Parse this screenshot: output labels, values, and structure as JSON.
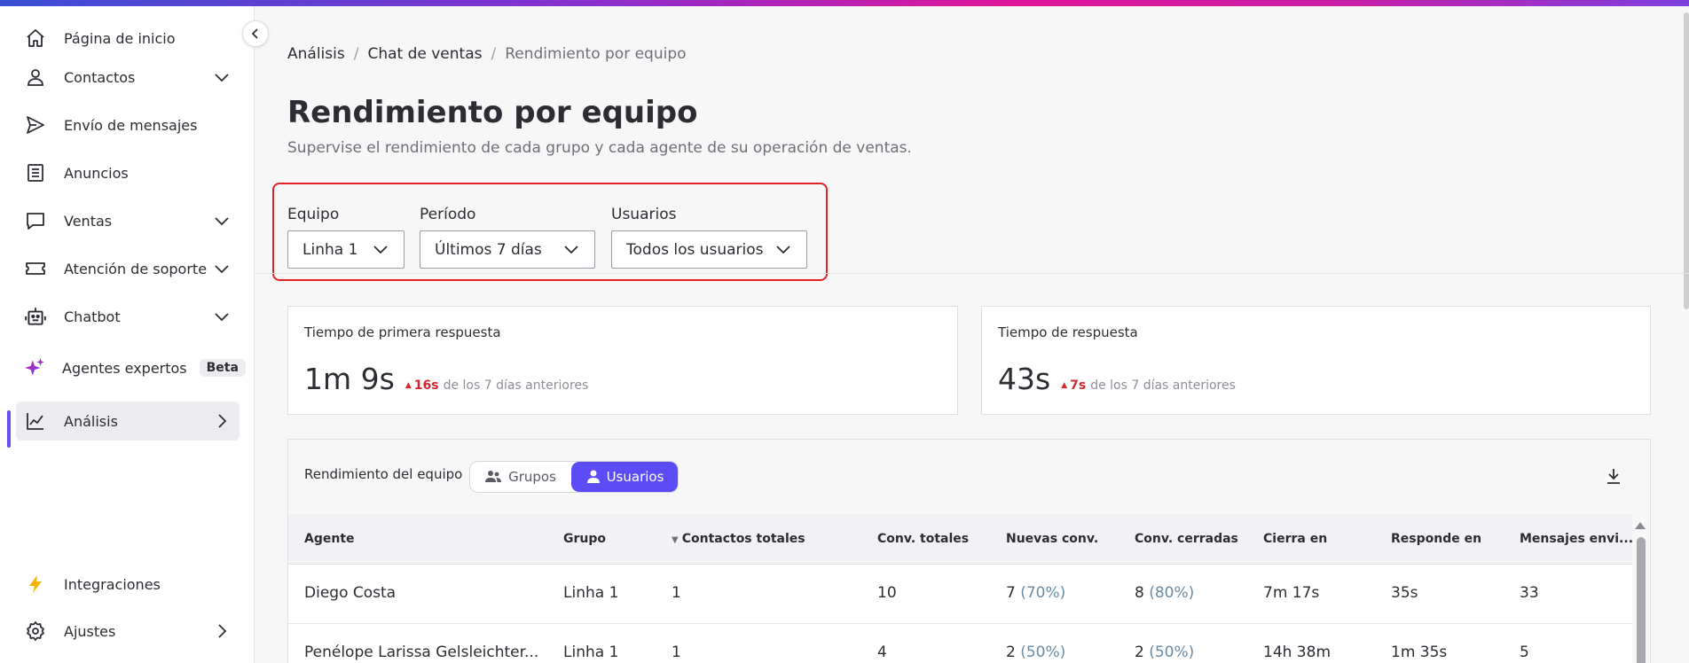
{
  "sidebar": {
    "items": [
      {
        "label": "Página de inicio",
        "icon": "home-icon"
      },
      {
        "label": "Contactos",
        "icon": "user-icon"
      },
      {
        "label": "Envío de mensajes",
        "icon": "send-icon"
      },
      {
        "label": "Anuncios",
        "icon": "document-icon"
      },
      {
        "label": "Ventas",
        "icon": "chat-icon"
      },
      {
        "label": "Atención de soporte",
        "icon": "ticket-icon"
      },
      {
        "label": "Chatbot",
        "icon": "robot-icon"
      },
      {
        "label": "Agentes expertos",
        "icon": "sparkle-icon",
        "badge": "Beta"
      },
      {
        "label": "Análisis",
        "icon": "chart-line-icon"
      },
      {
        "label": "Integraciones",
        "icon": "lightning-icon"
      },
      {
        "label": "Ajustes",
        "icon": "gear-icon"
      }
    ]
  },
  "breadcrumb": {
    "items": [
      "Análisis",
      "Chat de ventas",
      "Rendimiento por equipo"
    ],
    "separator": "/"
  },
  "page": {
    "title": "Rendimiento por equipo",
    "subtitle": "Supervise el rendimiento de cada grupo y cada agente de su operación de ventas."
  },
  "filters": {
    "team": {
      "label": "Equipo",
      "value": "Linha 1"
    },
    "period": {
      "label": "Período",
      "value": "Últimos 7 días"
    },
    "users": {
      "label": "Usuarios",
      "value": "Todos los usuarios"
    }
  },
  "metrics": [
    {
      "title": "Tiempo de primera respuesta",
      "value": "1m 9s",
      "delta": "16s",
      "comparison": "de los 7 días anteriores"
    },
    {
      "title": "Tiempo de respuesta",
      "value": "43s",
      "delta": "7s",
      "comparison": "de los 7 días anteriores"
    }
  ],
  "performance": {
    "title": "Rendimiento del equipo",
    "toggle": {
      "groups": "Grupos",
      "users": "Usuarios",
      "selected": "Usuarios"
    },
    "columns": [
      "Agente",
      "Grupo",
      "Contactos totales",
      "Conv. totales",
      "Nuevas conv.",
      "Conv. cerradas",
      "Cierra en",
      "Responde en",
      "Mensajes envi..."
    ],
    "rows": [
      {
        "agent": "Diego Costa",
        "group": "Linha 1",
        "contacts": "1",
        "convs": "10",
        "new_val": "7",
        "new_pct": "(70%)",
        "closed_val": "8",
        "closed_pct": "(80%)",
        "closes_in": "7m 17s",
        "responds_in": "35s",
        "messages": "33"
      },
      {
        "agent": "Penélope Larissa Gelsleichter...",
        "group": "Linha 1",
        "contacts": "1",
        "convs": "4",
        "new_val": "2",
        "new_pct": "(50%)",
        "closed_val": "2",
        "closed_pct": "(50%)",
        "closes_in": "14h 38m",
        "responds_in": "1m 35s",
        "messages": "5"
      }
    ]
  },
  "colors": {
    "accent": "#5b4cf5",
    "highlight_border": "#e0242a",
    "delta_red": "#d3262d",
    "pct_blue": "#6a8ba5"
  }
}
